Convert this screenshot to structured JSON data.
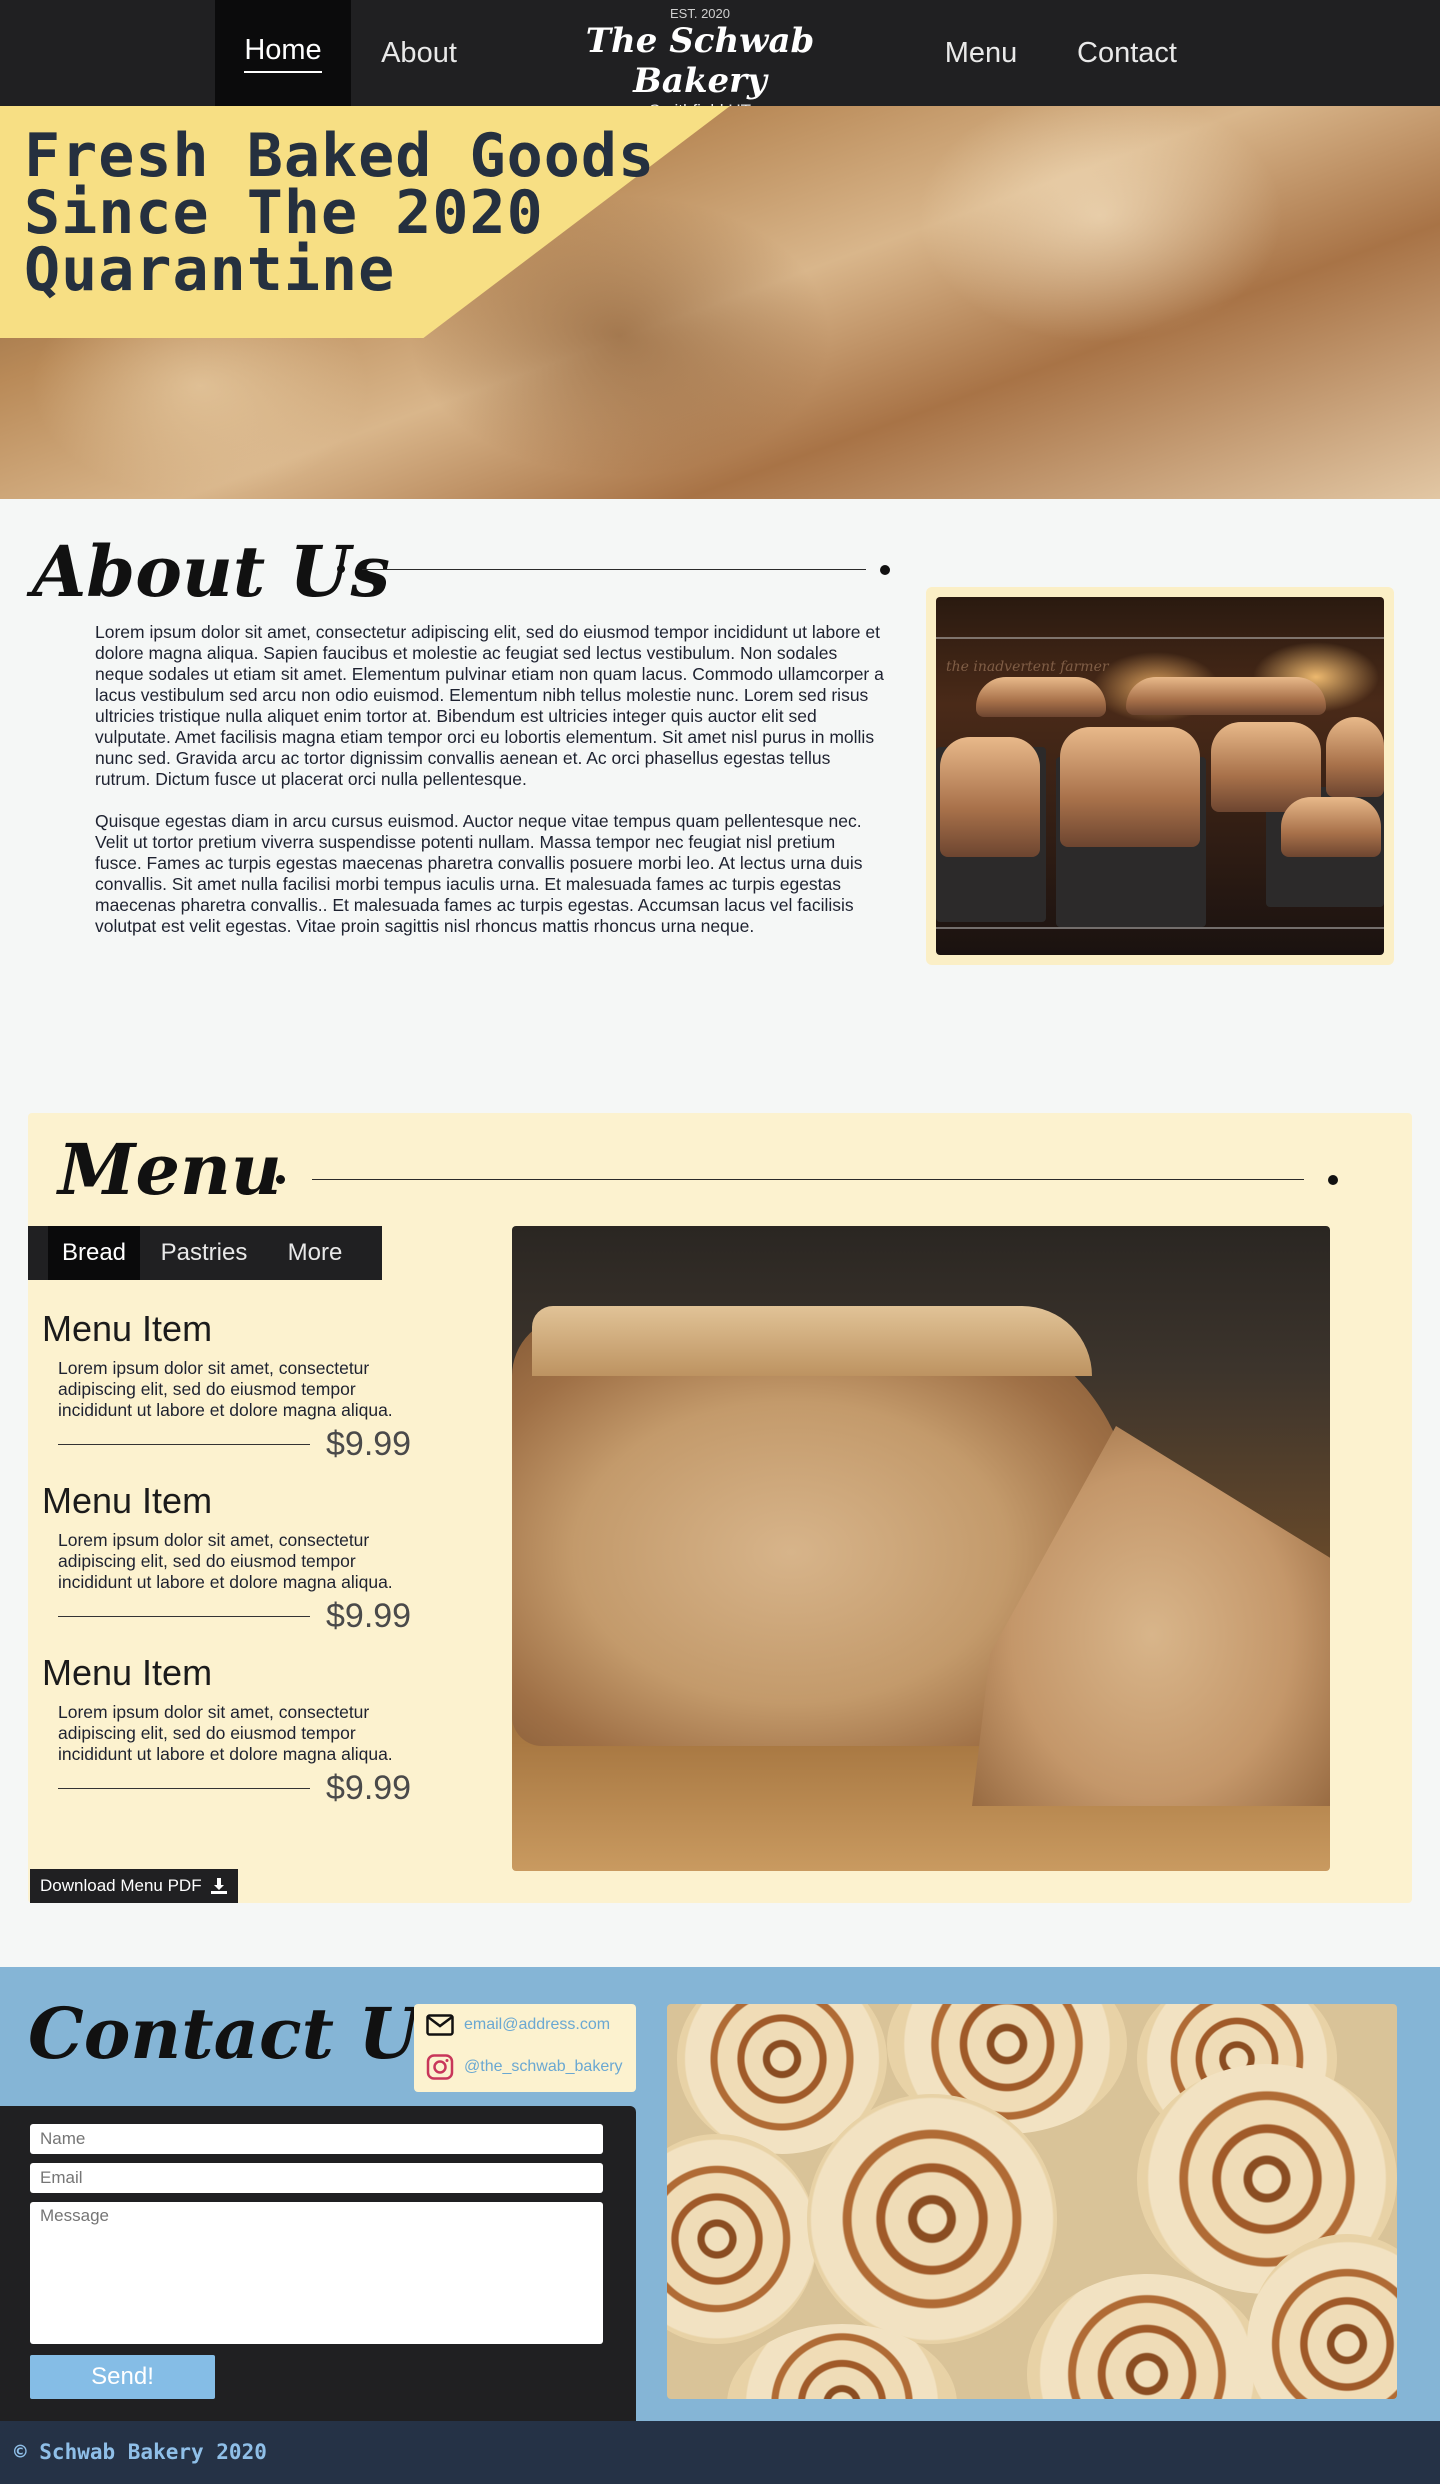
{
  "nav": {
    "left": [
      "Home",
      "About"
    ],
    "right": [
      "Menu",
      "Contact"
    ],
    "active": "Home"
  },
  "brand": {
    "est": "EST. 2020",
    "name": "The Schwab Bakery",
    "location": "Smithfield UT"
  },
  "hero": {
    "title_lines": [
      "Fresh Baked Goods",
      "Since The 2020",
      "Quarantine"
    ]
  },
  "about": {
    "title": "About Us",
    "paragraphs": [
      "Lorem ipsum dolor sit amet, consectetur adipiscing elit, sed do eiusmod tempor incididunt ut labore et dolore magna aliqua. Sapien faucibus et molestie ac feugiat sed lectus vestibulum. Non sodales neque sodales ut etiam sit amet. Elementum pulvinar etiam non quam lacus. Commodo ullamcorper a lacus vestibulum sed arcu non odio euismod. Elementum nibh tellus molestie nunc. Lorem sed risus ultricies tristique nulla aliquet enim tortor at. Bibendum est ultricies integer quis auctor elit sed vulputate. Amet facilisis magna etiam tempor orci eu lobortis elementum. Sit amet nisl purus in mollis nunc sed. Gravida arcu ac tortor dignissim convallis aenean et. Ac orci phasellus egestas tellus rutrum. Dictum fusce ut placerat orci nulla pellentesque.",
      "Quisque egestas diam in arcu cursus euismod. Auctor neque vitae tempus quam pellentesque nec. Velit ut tortor pretium viverra suspendisse potenti nullam. Massa tempor nec feugiat nisl pretium fusce. Fames ac turpis egestas maecenas pharetra convallis posuere morbi leo. At lectus urna duis convallis. Sit amet nulla facilisi morbi tempus iaculis urna. Et malesuada fames ac turpis egestas maecenas pharetra convallis.. Et malesuada fames ac turpis egestas. Accumsan lacus vel facilisis volutpat est velit egestas. Vitae proin sagittis nisl rhoncus mattis rhoncus urna neque."
    ],
    "photo_watermark": "the inadvertent farmer"
  },
  "menu": {
    "title": "Menu",
    "tabs": [
      "Bread",
      "Pastries",
      "More"
    ],
    "active_tab": "Bread",
    "items": [
      {
        "name": "Menu Item",
        "desc": "Lorem ipsum dolor sit amet, consectetur adipiscing elit, sed do eiusmod tempor incididunt ut labore et dolore magna aliqua.",
        "price": "$9.99"
      },
      {
        "name": "Menu Item",
        "desc": "Lorem ipsum dolor sit amet, consectetur adipiscing elit, sed do eiusmod tempor incididunt ut labore et dolore magna aliqua.",
        "price": "$9.99"
      },
      {
        "name": "Menu Item",
        "desc": "Lorem ipsum dolor sit amet, consectetur adipiscing elit, sed do eiusmod tempor incididunt ut labore et dolore magna aliqua.",
        "price": "$9.99"
      }
    ],
    "download_label": "Download Menu PDF"
  },
  "contact": {
    "title": "Contact Us",
    "email": "email@address.com",
    "instagram": "@the_schwab_bakery",
    "form": {
      "name_placeholder": "Name",
      "email_placeholder": "Email",
      "message_placeholder": "Message",
      "send_label": "Send!"
    }
  },
  "footer": {
    "text": "© Schwab Bakery 2020"
  },
  "colors": {
    "nav_bg": "#202022",
    "hero_banner": "#f7df84",
    "menu_bg": "#fcf2cf",
    "contact_bg": "#85b5d6",
    "footer_bg": "#253246",
    "accent_blue": "#85bde6"
  }
}
